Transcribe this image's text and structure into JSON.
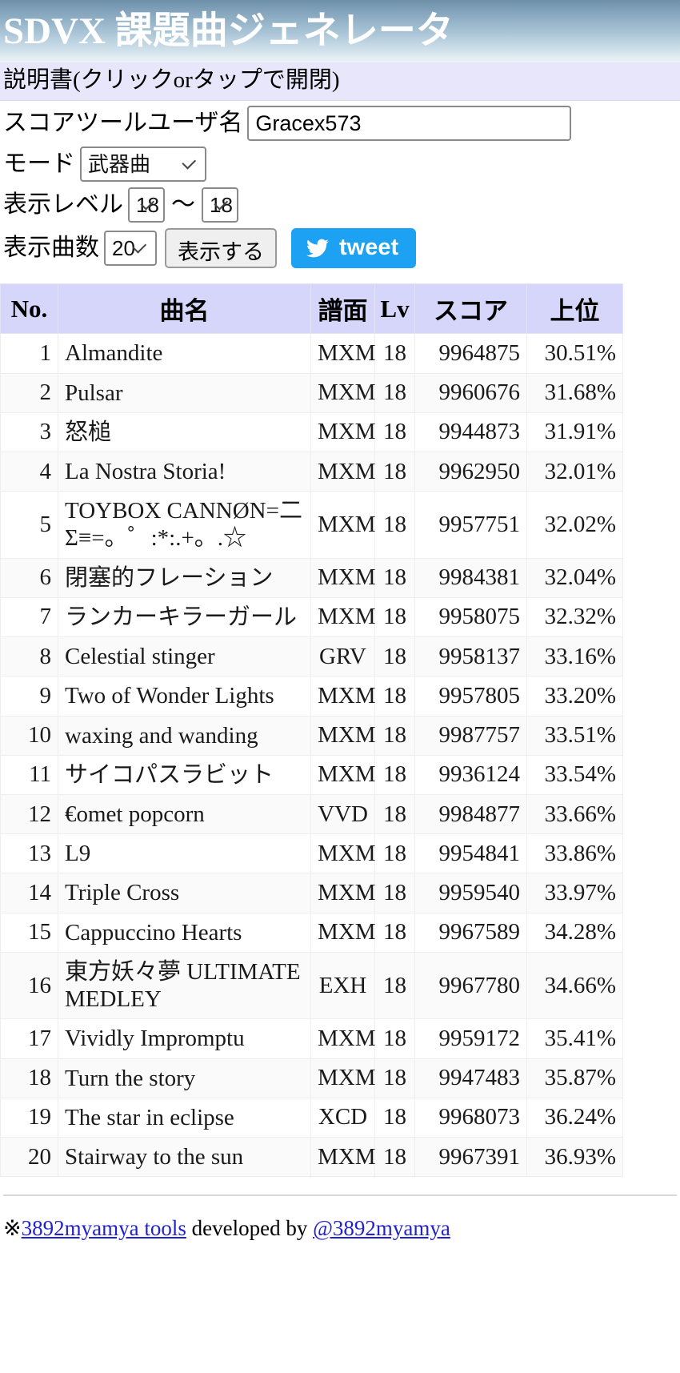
{
  "header": {
    "title": "SDVX 課題曲ジェネレータ"
  },
  "instructions": {
    "label": "説明書(クリックorタップで開閉)"
  },
  "form": {
    "username_label": "スコアツールユーザ名",
    "username_value": "Gracex573",
    "username_placeholder": "",
    "mode_label": "モード",
    "mode_value": "武器曲",
    "mode_options": [
      "武器曲"
    ],
    "level_label": "表示レベル",
    "level_from": "18",
    "level_to": "18",
    "level_options": [
      "18"
    ],
    "level_separator": "〜",
    "count_label": "表示曲数",
    "count_value": "20",
    "count_options": [
      "20"
    ],
    "show_button": "表示する",
    "tweet_button": "tweet"
  },
  "table": {
    "columns": [
      "No.",
      "曲名",
      "譜面",
      "Lv",
      "スコア",
      "上位"
    ],
    "rows": [
      {
        "no": "1",
        "title": "Almandite",
        "dif": "MXM",
        "lv": "18",
        "score": "9964875",
        "rank": "30.51%"
      },
      {
        "no": "2",
        "title": "Pulsar",
        "dif": "MXM",
        "lv": "18",
        "score": "9960676",
        "rank": "31.68%"
      },
      {
        "no": "3",
        "title": "怒槌",
        "dif": "MXM",
        "lv": "18",
        "score": "9944873",
        "rank": "31.91%"
      },
      {
        "no": "4",
        "title": "La Nostra Storia!",
        "dif": "MXM",
        "lv": "18",
        "score": "9962950",
        "rank": "32.01%"
      },
      {
        "no": "5",
        "title": "TOYBOX CANNØN=二Σ≡=。゜:*:.+。.☆",
        "dif": "MXM",
        "lv": "18",
        "score": "9957751",
        "rank": "32.02%"
      },
      {
        "no": "6",
        "title": "閉塞的フレーション",
        "dif": "MXM",
        "lv": "18",
        "score": "9984381",
        "rank": "32.04%"
      },
      {
        "no": "7",
        "title": "ランカーキラーガール",
        "dif": "MXM",
        "lv": "18",
        "score": "9958075",
        "rank": "32.32%"
      },
      {
        "no": "8",
        "title": "Celestial stinger",
        "dif": "GRV",
        "lv": "18",
        "score": "9958137",
        "rank": "33.16%"
      },
      {
        "no": "9",
        "title": "Two of Wonder Lights",
        "dif": "MXM",
        "lv": "18",
        "score": "9957805",
        "rank": "33.20%"
      },
      {
        "no": "10",
        "title": "waxing and wanding",
        "dif": "MXM",
        "lv": "18",
        "score": "9987757",
        "rank": "33.51%"
      },
      {
        "no": "11",
        "title": "サイコパスラビット",
        "dif": "MXM",
        "lv": "18",
        "score": "9936124",
        "rank": "33.54%"
      },
      {
        "no": "12",
        "title": "€omet popcorn",
        "dif": "VVD",
        "lv": "18",
        "score": "9984877",
        "rank": "33.66%"
      },
      {
        "no": "13",
        "title": "L9",
        "dif": "MXM",
        "lv": "18",
        "score": "9954841",
        "rank": "33.86%"
      },
      {
        "no": "14",
        "title": "Triple Cross",
        "dif": "MXM",
        "lv": "18",
        "score": "9959540",
        "rank": "33.97%"
      },
      {
        "no": "15",
        "title": "Cappuccino Hearts",
        "dif": "MXM",
        "lv": "18",
        "score": "9967589",
        "rank": "34.28%"
      },
      {
        "no": "16",
        "title": "東方妖々夢 ULTIMATE MEDLEY",
        "dif": "EXH",
        "lv": "18",
        "score": "9967780",
        "rank": "34.66%"
      },
      {
        "no": "17",
        "title": "Vividly Impromptu",
        "dif": "MXM",
        "lv": "18",
        "score": "9959172",
        "rank": "35.41%"
      },
      {
        "no": "18",
        "title": "Turn the story",
        "dif": "MXM",
        "lv": "18",
        "score": "9947483",
        "rank": "35.87%"
      },
      {
        "no": "19",
        "title": "The star in eclipse",
        "dif": "XCD",
        "lv": "18",
        "score": "9968073",
        "rank": "36.24%"
      },
      {
        "no": "20",
        "title": "Stairway to the sun",
        "dif": "MXM",
        "lv": "18",
        "score": "9967391",
        "rank": "36.93%"
      }
    ]
  },
  "footer": {
    "prefix": "※",
    "tool_link": "3892myamya tools",
    "middle": " developed by ",
    "author_link": "@3892myamya"
  },
  "colors": {
    "banner_start": "#6d8fa8",
    "banner_end": "#eef4f8",
    "instructions_bg": "#e7e6fb",
    "table_header_bg": "#d6d6fb",
    "tweet_blue": "#1da1f2",
    "dif_MXM": "#6b6b6b",
    "dif_GRV": "#e8a317",
    "dif_VVD": "#e8246c",
    "dif_EXH": "#e8315c",
    "dif_XCD": "#49aee8",
    "link": "#2222cc"
  }
}
